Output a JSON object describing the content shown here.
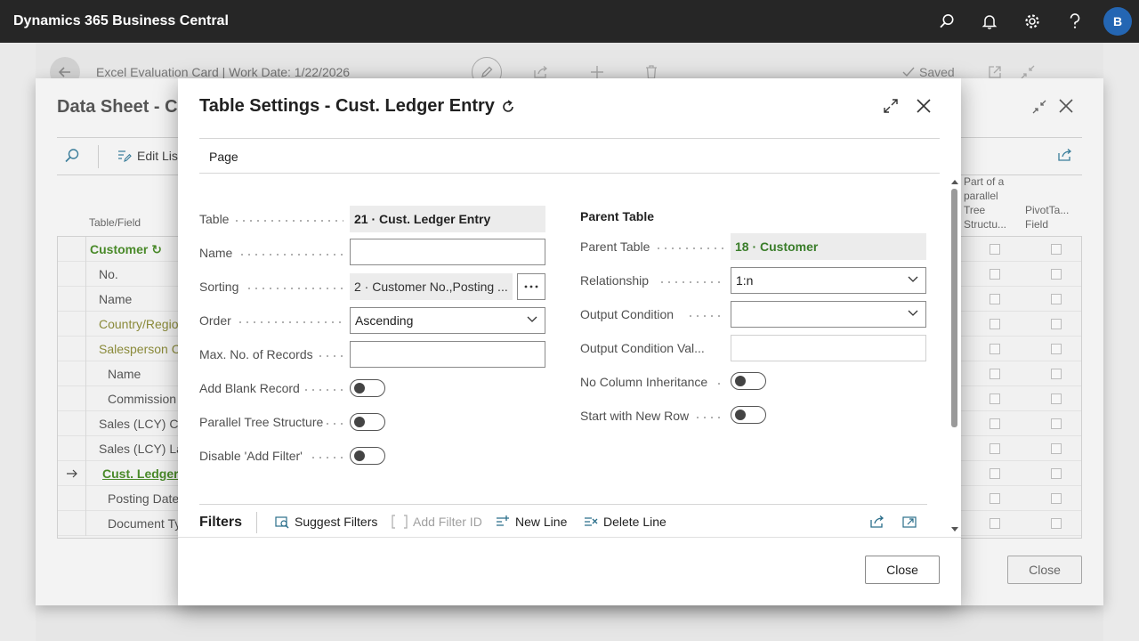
{
  "app": {
    "title": "Dynamics 365 Business Central",
    "user_initial": "B"
  },
  "background_page": {
    "title": "Excel Evaluation Card | Work Date: 1/22/2026",
    "saved_label": "Saved"
  },
  "data_sheet": {
    "title": "Data Sheet - Cu",
    "edit_list_label": "Edit List",
    "col_table_field": "Table/Field",
    "col_parallel": "Part of a parallel Tree Structu...",
    "col_pivot": "PivotTa... Field",
    "rows": [
      {
        "text": "Customer ↻",
        "style": "green-bold"
      },
      {
        "text": "No.",
        "style": "plain"
      },
      {
        "text": "Name",
        "style": "plain"
      },
      {
        "text": "Country/Regio",
        "style": "olive"
      },
      {
        "text": "Salesperson Co",
        "style": "olive"
      },
      {
        "text": "Name",
        "style": "indent"
      },
      {
        "text": "Commission",
        "style": "indent"
      },
      {
        "text": "Sales (LCY) Cur",
        "style": "plain"
      },
      {
        "text": "Sales (LCY) Las",
        "style": "plain"
      },
      {
        "text": "Cust. Ledger",
        "style": "link"
      },
      {
        "text": "Posting Date",
        "style": "indent"
      },
      {
        "text": "Document Ty",
        "style": "indent"
      }
    ],
    "close_label": "Close"
  },
  "dialog": {
    "title": "Table Settings - Cust. Ledger Entry",
    "tab_page": "Page",
    "left_fields": {
      "table_label": "Table",
      "table_value": "21 · Cust. Ledger Entry",
      "name_label": "Name",
      "name_value": "",
      "sorting_label": "Sorting",
      "sorting_value": "2 · Customer No.,Posting ...",
      "order_label": "Order",
      "order_value": "Ascending",
      "max_label": "Max. No. of Records",
      "max_value": "",
      "blank_label": "Add Blank Record",
      "parallel_label": "Parallel Tree Structure",
      "disable_label": "Disable 'Add Filter'"
    },
    "right_fields": {
      "section_title": "Parent Table",
      "parent_label": "Parent Table",
      "parent_value": "18 · Customer",
      "relationship_label": "Relationship",
      "relationship_value": "1:n",
      "output_cond_label": "Output Condition",
      "output_cond_value": "",
      "output_val_label": "Output Condition Val...",
      "output_val_value": "",
      "no_inherit_label": "No Column Inheritance",
      "new_row_label": "Start with New Row"
    },
    "toggles": {
      "add_blank": false,
      "parallel": false,
      "disable_filter": false,
      "no_inherit": false,
      "new_row": false
    },
    "filters": {
      "title": "Filters",
      "suggest": "Suggest Filters",
      "add_filter_id": "Add Filter ID",
      "new_line": "New Line",
      "delete_line": "Delete Line"
    },
    "close_label": "Close"
  },
  "colors": {
    "accent_green": "#3a7d2a",
    "brand_blue": "#2466b3",
    "topbar": "#262626"
  }
}
